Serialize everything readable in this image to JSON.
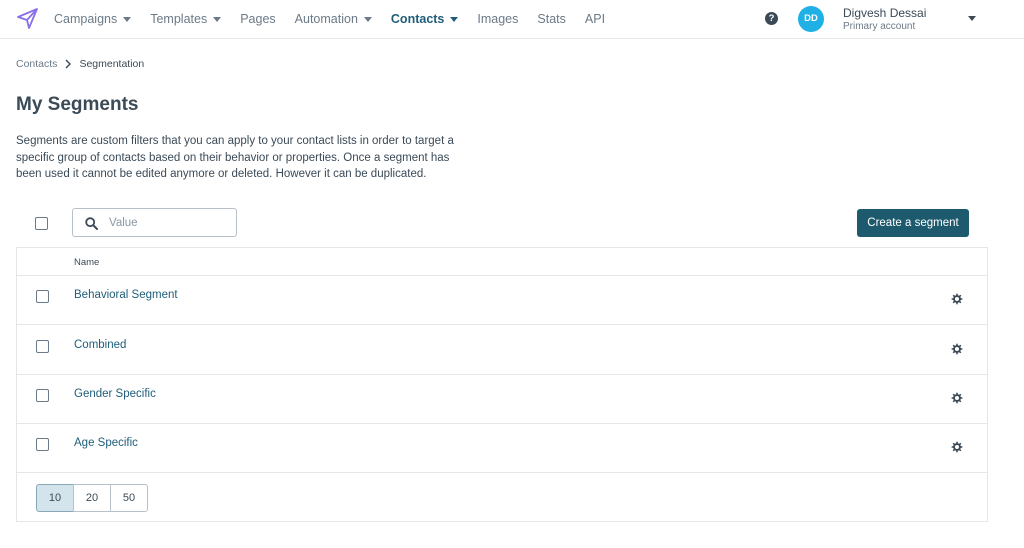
{
  "nav": {
    "items": [
      {
        "label": "Campaigns",
        "dropdown": true,
        "active": false
      },
      {
        "label": "Templates",
        "dropdown": true,
        "active": false
      },
      {
        "label": "Pages",
        "dropdown": false,
        "active": false
      },
      {
        "label": "Automation",
        "dropdown": true,
        "active": false
      },
      {
        "label": "Contacts",
        "dropdown": true,
        "active": true
      },
      {
        "label": "Images",
        "dropdown": false,
        "active": false
      },
      {
        "label": "Stats",
        "dropdown": false,
        "active": false
      },
      {
        "label": "API",
        "dropdown": false,
        "active": false
      }
    ],
    "help_glyph": "?",
    "user": {
      "initials": "DD",
      "name": "Digvesh Dessai",
      "account": "Primary account"
    }
  },
  "breadcrumb": {
    "parent": "Contacts",
    "current": "Segmentation"
  },
  "page": {
    "title": "My Segments",
    "description": "Segments are custom filters that you can apply to your contact lists in order to target a specific group of contacts based on their behavior or properties. Once a segment has been used it cannot be edited anymore or deleted. However it can be duplicated."
  },
  "toolbar": {
    "search_placeholder": "Value",
    "create_label": "Create a segment"
  },
  "table": {
    "header_name": "Name",
    "rows": [
      {
        "name": "Behavioral Segment"
      },
      {
        "name": "Combined"
      },
      {
        "name": "Gender Specific"
      },
      {
        "name": "Age Specific"
      }
    ]
  },
  "pagination": {
    "options": [
      "10",
      "20",
      "50"
    ],
    "selected": "10"
  },
  "colors": {
    "primary": "#1d5a6e",
    "accent_blue": "#1fb0e6",
    "logo_purple": "#8b6fe8",
    "link": "#1f5d7a"
  },
  "icons": {
    "logo": "paper-plane-icon",
    "search": "search-icon",
    "row_action": "gear-icon",
    "help": "help-icon"
  }
}
